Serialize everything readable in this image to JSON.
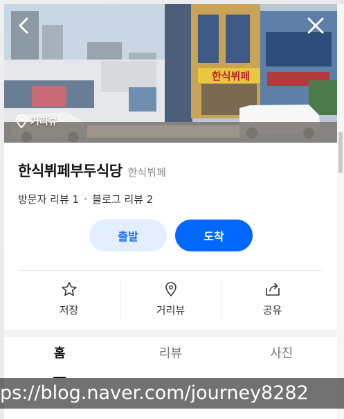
{
  "header": {
    "back_icon": "chevron-left-icon",
    "close_icon": "close-icon"
  },
  "photo": {
    "streetview_label": "거리뷰",
    "sign_text": "한식뷔페"
  },
  "place": {
    "name": "한식뷔페부두식당",
    "category": "한식뷔페",
    "visitor_reviews": "방문자 리뷰 1",
    "blog_reviews": "블로그 리뷰 2"
  },
  "buttons": {
    "start_label": "출발",
    "arrive_label": "도착"
  },
  "actions": [
    {
      "label": "저장",
      "icon": "star-icon"
    },
    {
      "label": "거리뷰",
      "icon": "location-pin-icon"
    },
    {
      "label": "공유",
      "icon": "share-icon"
    }
  ],
  "tabs": [
    {
      "label": "홈",
      "active": true
    },
    {
      "label": "리뷰",
      "active": false
    },
    {
      "label": "사진",
      "active": false
    }
  ],
  "colors": {
    "primary": "#0068ff",
    "primary_light": "#e3efff",
    "text": "#111111",
    "muted": "#8a8a8a"
  },
  "watermark": "ps://blog.naver.com/journey8282"
}
